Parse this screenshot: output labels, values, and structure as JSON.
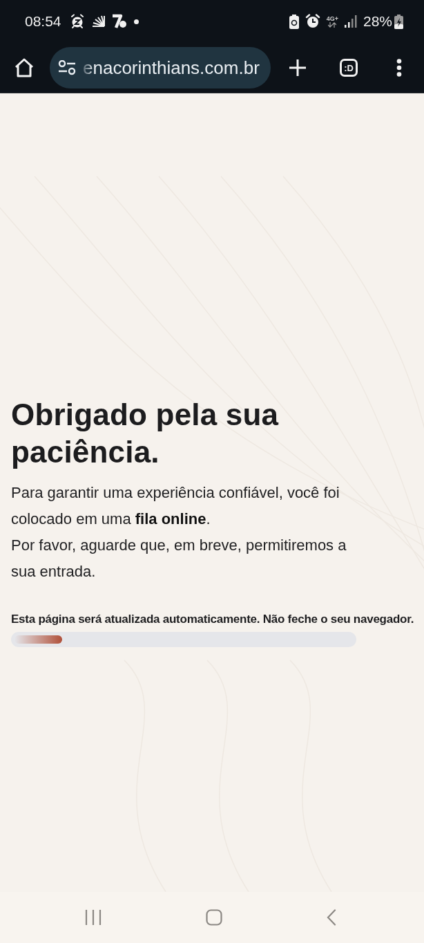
{
  "status_bar": {
    "time": "08:54",
    "network": "4G+",
    "battery": "28%"
  },
  "browser_toolbar": {
    "url": "enacorinthians.com.br",
    "tab_label": ":D"
  },
  "page": {
    "heading": "Obrigado pela sua paciência.",
    "paragraphs": [
      "Para garantir uma experiência confiável, você foi colocado em uma **fila online**.",
      "Por favor, aguarde que, em breve, permitiremos a sua entrada."
    ],
    "notice": "Esta página será atualizada automaticamente. Não feche o seu navegador.",
    "progress": {
      "level": 0.14
    }
  }
}
